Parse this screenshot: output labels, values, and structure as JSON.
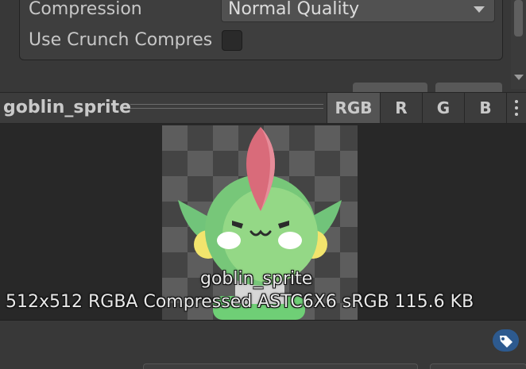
{
  "settings": {
    "compression_label": "Compression",
    "compression_value": "Normal Quality",
    "crunch_label": "Use Crunch Compres",
    "crunch_checked": false
  },
  "preview": {
    "asset_name": "goblin_sprite",
    "channels": [
      "RGB",
      "R",
      "G",
      "B"
    ],
    "active_channel": "RGB",
    "overlay_name": "goblin_sprite",
    "info": "512x512  RGBA Compressed ASTC6X6 sRGB   115.6 KB"
  },
  "icons": {
    "dropdown": "chevron-down-icon",
    "more": "kebab-menu-icon",
    "tag": "asset-label-icon",
    "scroll": "scroll-down-arrow-icon"
  },
  "colors": {
    "badge": "#2d5a8f",
    "active_channel_bg": "#545454"
  }
}
